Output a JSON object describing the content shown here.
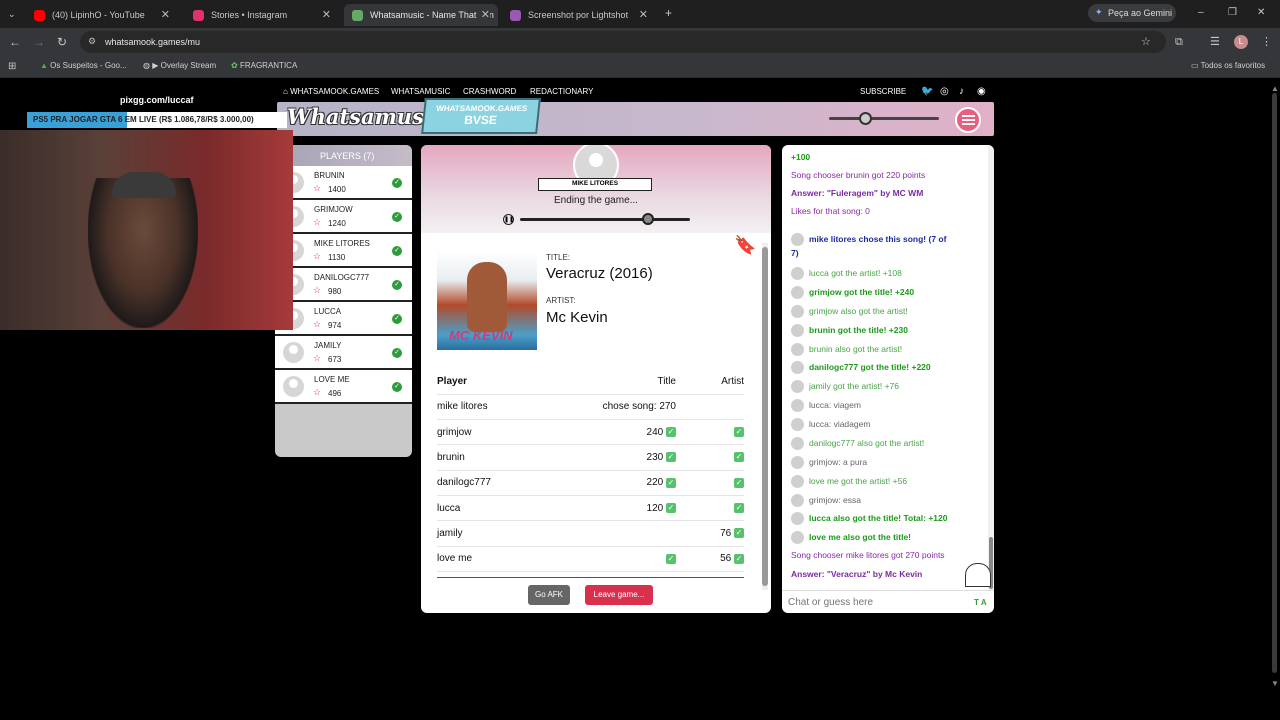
{
  "browser": {
    "tabs": [
      {
        "title": "(40) LipinhO - YouTube",
        "color": "#ff0000"
      },
      {
        "title": "Stories • Instagram",
        "color": "#e1306c"
      },
      {
        "title": "Whatsamusic - Name That Tun",
        "color": "#6a6"
      },
      {
        "title": "Screenshot por Lightshot",
        "color": "#9b59b6"
      }
    ],
    "gemini": "Peça ao Gemini",
    "url": "whatsamook.games/mu",
    "bookmarks": [
      "Os Suspeitos - Goo...",
      "▶ Overlay Stream",
      "FRAGRANTICA"
    ],
    "all_bookmarks": "Todos os favoritos",
    "profile": "L"
  },
  "site_nav": {
    "items": [
      "WHATSAMOOK.GAMES",
      "WHATSAMUSIC",
      "CRASHWORD",
      "REDACTIONARY"
    ],
    "subscribe": "SUBSCRIBE"
  },
  "header": {
    "logo": "Whatsamusic",
    "room_site": "WHATSAMOOK.GAMES",
    "room_code": "BVSE"
  },
  "stream": {
    "handle": "pixgg.com/luccaf",
    "promo": "PS5 PRA JOGAR GTA 6 EM LIVE (R$ 1.086,78/R$ 3.000,00)"
  },
  "players_panel": {
    "title": "PLAYERS (7)",
    "players": [
      {
        "name": "BRUNIN",
        "points": "1400"
      },
      {
        "name": "GRIMJOW",
        "points": "1240"
      },
      {
        "name": "MIKE LITORES",
        "points": "1130"
      },
      {
        "name": "DANILOGC777",
        "points": "980"
      },
      {
        "name": "LUCCA",
        "points": "974"
      },
      {
        "name": "JAMILY",
        "points": "673"
      },
      {
        "name": "LOVE ME",
        "points": "496"
      }
    ]
  },
  "game": {
    "chooser": "MIKE LITORES",
    "status": "Ending the game...",
    "title_label": "TITLE:",
    "title": "Veracruz (2016)",
    "artist_label": "ARTIST:",
    "artist": "Mc Kevin",
    "cover_text": "MC KEVIN",
    "progress": 0.75,
    "table": {
      "headers": [
        "Player",
        "Title",
        "Artist"
      ],
      "rows": [
        {
          "player": "mike litores",
          "title": "chose song: 270",
          "title_check": false,
          "artist": "",
          "artist_check": false
        },
        {
          "player": "grimjow",
          "title": "240",
          "title_check": true,
          "artist": "",
          "artist_check": true
        },
        {
          "player": "brunin",
          "title": "230",
          "title_check": true,
          "artist": "",
          "artist_check": true
        },
        {
          "player": "danilogc777",
          "title": "220",
          "title_check": true,
          "artist": "",
          "artist_check": true
        },
        {
          "player": "lucca",
          "title": "120",
          "title_check": true,
          "artist": "",
          "artist_check": true
        },
        {
          "player": "jamily",
          "title": "",
          "title_check": false,
          "artist": "76",
          "artist_check": true
        },
        {
          "player": "love me",
          "title": "",
          "title_check": true,
          "artist": "56",
          "artist_check": true
        }
      ]
    },
    "afk_button": "Go AFK",
    "leave_button": "Leave game..."
  },
  "chat": {
    "messages": [
      {
        "text": "+100",
        "style": "g",
        "avatar": false
      },
      {
        "text": "Song chooser brunin got 220 points",
        "style": "p",
        "avatar": false
      },
      {
        "text": "Answer: \"Fuleragem\" by MC WM",
        "style": "pb",
        "avatar": false
      },
      {
        "text": "Likes for that song: 0",
        "style": "p",
        "avatar": false
      },
      {
        "text": "mike litores chose this song! (7 of",
        "style": "b",
        "avatar": true
      },
      {
        "text": "7)",
        "style": "b",
        "avatar": false
      },
      {
        "text": "lucca got the artist! +108",
        "style": "lg",
        "avatar": true
      },
      {
        "text": "grimjow got the title! +240",
        "style": "g",
        "avatar": true
      },
      {
        "text": "grimjow also got the artist!",
        "style": "lg",
        "avatar": true
      },
      {
        "text": "brunin got the title! +230",
        "style": "g",
        "avatar": true
      },
      {
        "text": "brunin also got the artist!",
        "style": "lg",
        "avatar": true
      },
      {
        "text": "danilogc777 got the title! +220",
        "style": "g",
        "avatar": true
      },
      {
        "text": "jamily got the artist! +76",
        "style": "lg",
        "avatar": true
      },
      {
        "text": "lucca: viagem",
        "style": "gr",
        "avatar": true
      },
      {
        "text": "lucca: viadagem",
        "style": "gr",
        "avatar": true
      },
      {
        "text": "danilogc777 also got the artist!",
        "style": "lg",
        "avatar": true
      },
      {
        "text": "grimjow: a pura",
        "style": "gr",
        "avatar": true
      },
      {
        "text": "love me got the artist! +56",
        "style": "lg",
        "avatar": true
      },
      {
        "text": "grimjow: essa",
        "style": "gr",
        "avatar": true
      },
      {
        "text": "lucca also got the title! Total: +120",
        "style": "g",
        "avatar": true
      },
      {
        "text": "love me also got the title!",
        "style": "g",
        "avatar": true
      },
      {
        "text": "Song chooser mike litores got 270 points",
        "style": "p",
        "avatar": false
      },
      {
        "text": "Answer: \"Veracruz\" by Mc Kevin",
        "style": "pb",
        "avatar": false
      }
    ],
    "placeholder": "Chat or guess here",
    "input_badge": "T A"
  }
}
